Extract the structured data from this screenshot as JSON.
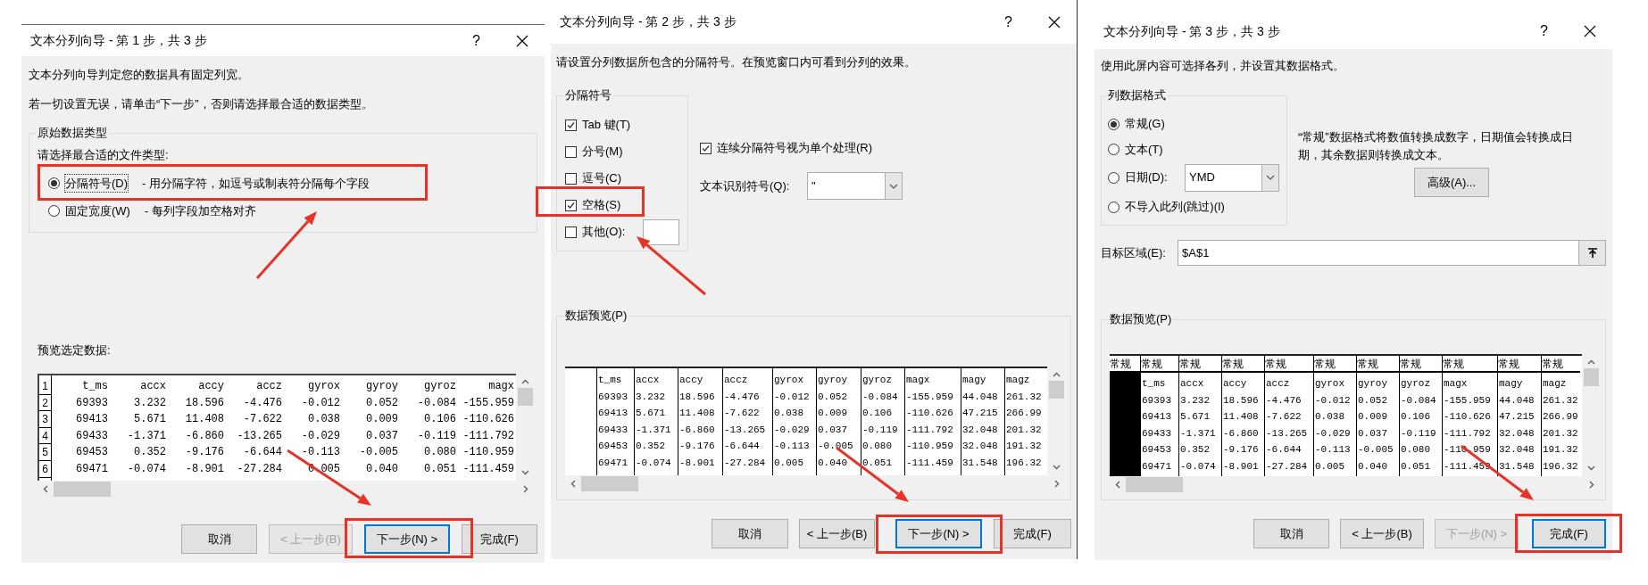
{
  "dialogs": [
    {
      "kind": "type_select",
      "title": "文本分列向导 - 第 1 步，共 3 步",
      "help": "?",
      "intro": [
        "文本分列向导判定您的数据具有固定列宽。",
        "若一切设置无误，请单击“下一步”，否则请选择最合适的数据类型。"
      ],
      "group": "原始数据类型",
      "prompt": "请选择最合适的文件类型:",
      "options": [
        {
          "label": "分隔符号(D)",
          "description": "- 用分隔字符，如逗号或制表符分隔每个字段",
          "selected": true
        },
        {
          "label": "固定宽度(W)",
          "description": "- 每列字段加空格对齐",
          "selected": false
        }
      ],
      "preview": {
        "label": "预览选定数据:",
        "row_numbers": [
          "1",
          "2",
          "3",
          "4",
          "5",
          "6"
        ],
        "header": [
          "t_ms",
          "accx",
          "accy",
          "accz",
          "gyrox",
          "gyroy",
          "gyroz",
          "magx"
        ],
        "rows": [
          [
            "69393",
            "3.232",
            "18.596",
            "-4.476",
            "-0.012",
            "0.052",
            "-0.084",
            "-155.959"
          ],
          [
            "69413",
            "5.671",
            "11.408",
            "-7.622",
            "0.038",
            "0.009",
            "0.106",
            "-110.626"
          ],
          [
            "69433",
            "-1.371",
            "-6.860",
            "-13.265",
            "-0.029",
            "0.037",
            "-0.119",
            "-111.792"
          ],
          [
            "69453",
            "0.352",
            "-9.176",
            "-6.644",
            "-0.113",
            "-0.005",
            "0.080",
            "-110.959"
          ],
          [
            "69471",
            "-0.074",
            "-8.901",
            "-27.284",
            "0.005",
            "0.040",
            "0.051",
            "-111.459"
          ]
        ]
      },
      "buttons": [
        {
          "label": "取消",
          "disabled": false,
          "default": false
        },
        {
          "label": "< 上一步(B)",
          "disabled": true,
          "default": false
        },
        {
          "label": "下一步(N) >",
          "disabled": false,
          "default": true
        },
        {
          "label": "完成(F)",
          "disabled": false,
          "default": false
        }
      ]
    },
    {
      "kind": "delimiters",
      "title": "文本分列向导 - 第 2 步，共 3 步",
      "help": "?",
      "intro": [
        "请设置分列数据所包含的分隔符号。在预览窗口内可看到分列的效果。"
      ],
      "group": "分隔符号",
      "delimiters": [
        {
          "label": "Tab 键(T)",
          "checked": true,
          "kind": "plain"
        },
        {
          "label": "分号(M)",
          "checked": false,
          "kind": "plain"
        },
        {
          "label": "逗号(C)",
          "checked": false,
          "kind": "plain"
        },
        {
          "label": "空格(S)",
          "checked": true,
          "kind": "plain"
        },
        {
          "label": "其他(O):",
          "checked": false,
          "kind": "input"
        }
      ],
      "consecutive": {
        "label": "连续分隔符号视为单个处理(R)",
        "checked": true
      },
      "qualifier": {
        "label": "文本识别符号(Q):",
        "value": "\""
      },
      "preview": {
        "label": "数据预览(P)",
        "blank_first_column": true,
        "header": [
          "t_ms",
          "accx",
          "accy",
          "accz",
          "gyrox",
          "gyroy",
          "gyroz",
          "magx",
          "magy",
          "magz"
        ],
        "rows": [
          [
            "69393",
            "3.232",
            "18.596",
            "-4.476",
            "-0.012",
            "0.052",
            "-0.084",
            "-155.959",
            "44.048",
            "261.32"
          ],
          [
            "69413",
            "5.671",
            "11.408",
            "-7.622",
            "0.038",
            "0.009",
            "0.106",
            "-110.626",
            "47.215",
            "266.99"
          ],
          [
            "69433",
            "-1.371",
            "-6.860",
            "-13.265",
            "-0.029",
            "0.037",
            "-0.119",
            "-111.792",
            "32.048",
            "201.32"
          ],
          [
            "69453",
            "0.352",
            "-9.176",
            "-6.644",
            "-0.113",
            "-0.005",
            "0.080",
            "-110.959",
            "32.048",
            "191.32"
          ],
          [
            "69471",
            "-0.074",
            "-8.901",
            "-27.284",
            "0.005",
            "0.040",
            "0.051",
            "-111.459",
            "31.548",
            "196.32"
          ]
        ]
      },
      "buttons": [
        {
          "label": "取消",
          "disabled": false,
          "default": false
        },
        {
          "label": "< 上一步(B)",
          "disabled": false,
          "default": false
        },
        {
          "label": "下一步(N) >",
          "disabled": false,
          "default": true
        },
        {
          "label": "完成(F)",
          "disabled": false,
          "default": false
        }
      ]
    },
    {
      "kind": "format",
      "title": "文本分列向导 - 第 3 步，共 3 步",
      "help": "?",
      "intro": [
        "使用此屏内容可选择各列，并设置其数据格式。"
      ],
      "group": "列数据格式",
      "formats": [
        {
          "label": "常规(G)",
          "selected": true,
          "kind": "plain"
        },
        {
          "label": "文本(T)",
          "selected": false,
          "kind": "plain"
        },
        {
          "label": "日期(D):",
          "selected": false,
          "kind": "dropdown",
          "value": "YMD"
        },
        {
          "label": "不导入此列(跳过)(I)",
          "selected": false,
          "kind": "plain"
        }
      ],
      "description": "“常规”数据格式将数值转换成数字，日期值会转换成日期，其余数据则转换成文本。",
      "advanced": "高级(A)...",
      "destination": {
        "label": "目标区域(E):",
        "value": "$A$1"
      },
      "preview": {
        "label": "数据预览(P)",
        "blank_first_column": true,
        "column_formats": [
          {
            "label": "常规",
            "selected": true
          },
          {
            "label": "常规",
            "selected": false
          },
          {
            "label": "常规",
            "selected": false
          },
          {
            "label": "常规",
            "selected": false
          },
          {
            "label": "常规",
            "selected": false
          },
          {
            "label": "常规",
            "selected": false
          },
          {
            "label": "常规",
            "selected": false
          },
          {
            "label": "常规",
            "selected": false
          },
          {
            "label": "常规",
            "selected": false
          },
          {
            "label": "常规",
            "selected": false
          },
          {
            "label": "常规",
            "selected": false
          }
        ],
        "header": [
          "t_ms",
          "accx",
          "accy",
          "accz",
          "gyrox",
          "gyroy",
          "gyroz",
          "magx",
          "magy",
          "magz"
        ],
        "rows": [
          [
            "69393",
            "3.232",
            "18.596",
            "-4.476",
            "-0.012",
            "0.052",
            "-0.084",
            "-155.959",
            "44.048",
            "261.32"
          ],
          [
            "69413",
            "5.671",
            "11.408",
            "-7.622",
            "0.038",
            "0.009",
            "0.106",
            "-110.626",
            "47.215",
            "266.99"
          ],
          [
            "69433",
            "-1.371",
            "-6.860",
            "-13.265",
            "-0.029",
            "0.037",
            "-0.119",
            "-111.792",
            "32.048",
            "201.32"
          ],
          [
            "69453",
            "0.352",
            "-9.176",
            "-6.644",
            "-0.113",
            "-0.005",
            "0.080",
            "-110.959",
            "32.048",
            "191.32"
          ],
          [
            "69471",
            "-0.074",
            "-8.901",
            "-27.284",
            "0.005",
            "0.040",
            "0.051",
            "-111.459",
            "31.548",
            "196.32"
          ]
        ]
      },
      "buttons": [
        {
          "label": "取消",
          "disabled": false,
          "default": false
        },
        {
          "label": "< 上一步(B)",
          "disabled": false,
          "default": false
        },
        {
          "label": "下一步(N) >",
          "disabled": true,
          "default": false
        },
        {
          "label": "完成(F)",
          "disabled": false,
          "default": true
        }
      ]
    }
  ]
}
